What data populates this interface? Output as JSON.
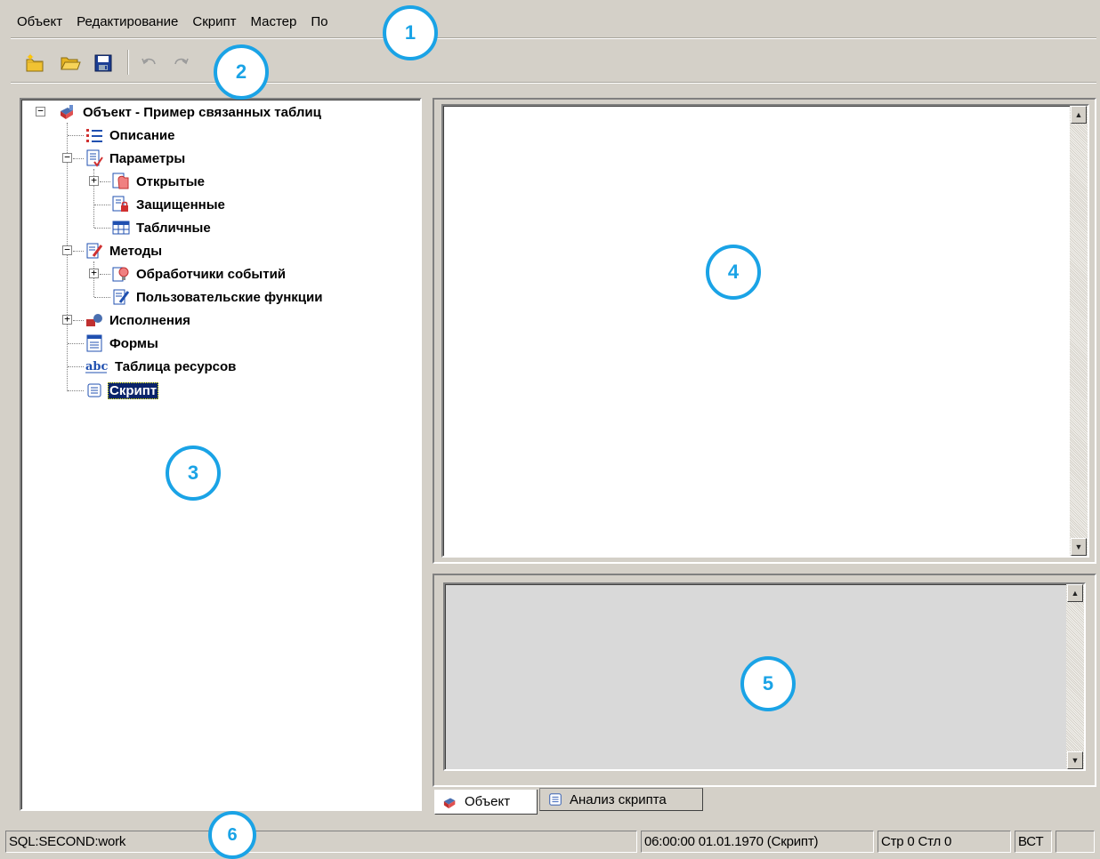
{
  "menu": [
    "Объект",
    "Редактирование",
    "Скрипт",
    "Мастер",
    "По"
  ],
  "toolbar": {
    "buttons": [
      "new-icon",
      "open-folder-icon",
      "save-icon",
      "undo-icon",
      "redo-icon"
    ]
  },
  "tree": {
    "items": [
      {
        "label": "Объект - Пример связанных таблиц",
        "icon": "object-icon"
      },
      {
        "label": "Описание",
        "icon": "list-icon"
      },
      {
        "label": "Параметры",
        "icon": "params-icon"
      },
      {
        "label": "Открытые",
        "icon": "open-params-icon"
      },
      {
        "label": "Защищенные",
        "icon": "protected-params-icon"
      },
      {
        "label": "Табличные",
        "icon": "table-icon"
      },
      {
        "label": "Методы",
        "icon": "methods-icon"
      },
      {
        "label": "Обработчики событий",
        "icon": "event-handlers-icon"
      },
      {
        "label": "Пользовательские функции",
        "icon": "user-functions-icon"
      },
      {
        "label": "Исполнения",
        "icon": "executions-icon"
      },
      {
        "label": "Формы",
        "icon": "forms-icon"
      },
      {
        "label": "Таблица ресурсов",
        "icon": "abc-icon"
      },
      {
        "label": "Скрипт",
        "icon": "script-icon"
      }
    ],
    "selected": "Скрипт"
  },
  "tabs": [
    {
      "label": "Объект",
      "icon": "object-icon",
      "active": true
    },
    {
      "label": "Анализ скрипта",
      "icon": "script-icon",
      "active": false
    }
  ],
  "status": {
    "connection": "SQL:SECOND:work",
    "datetime": "06:00:00  01.01.1970  (Скрипт)",
    "position": "Стр 0 Стл 0",
    "mode": "ВСТ"
  },
  "callouts": [
    "1",
    "2",
    "3",
    "4",
    "5",
    "6"
  ],
  "colors": {
    "callout": "#1aa3e6",
    "selection": "#0a246a",
    "face": "#d4d0c8"
  }
}
